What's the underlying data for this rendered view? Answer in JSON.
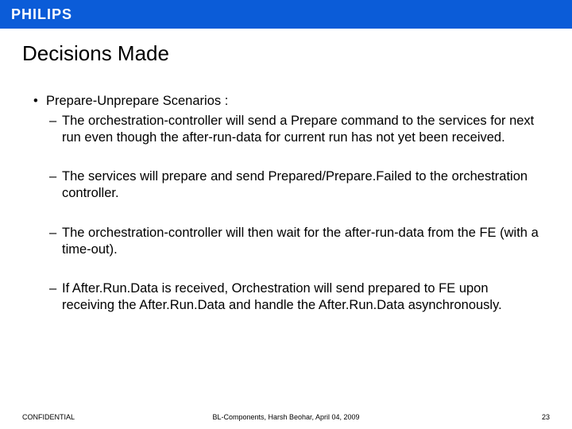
{
  "header": {
    "logo": "PHILIPS"
  },
  "title": "Decisions Made",
  "bullets": {
    "main": "Prepare-Unprepare Scenarios :",
    "subs": [
      "The orchestration-controller will send a Prepare command to the services for next run even though the after-run-data for current run has not yet been received.",
      "The services will prepare and send Prepared/Prepare.Failed to the orchestration controller.",
      "The orchestration-controller will then wait for the after-run-data from the FE (with a time-out).",
      "If After.Run.Data is received, Orchestration will send prepared to FE upon receiving the After.Run.Data and handle the After.Run.Data asynchronously."
    ]
  },
  "footer": {
    "left": "CONFIDENTIAL",
    "center": "BL-Components, Harsh Beohar, April 04, 2009",
    "right": "23"
  }
}
